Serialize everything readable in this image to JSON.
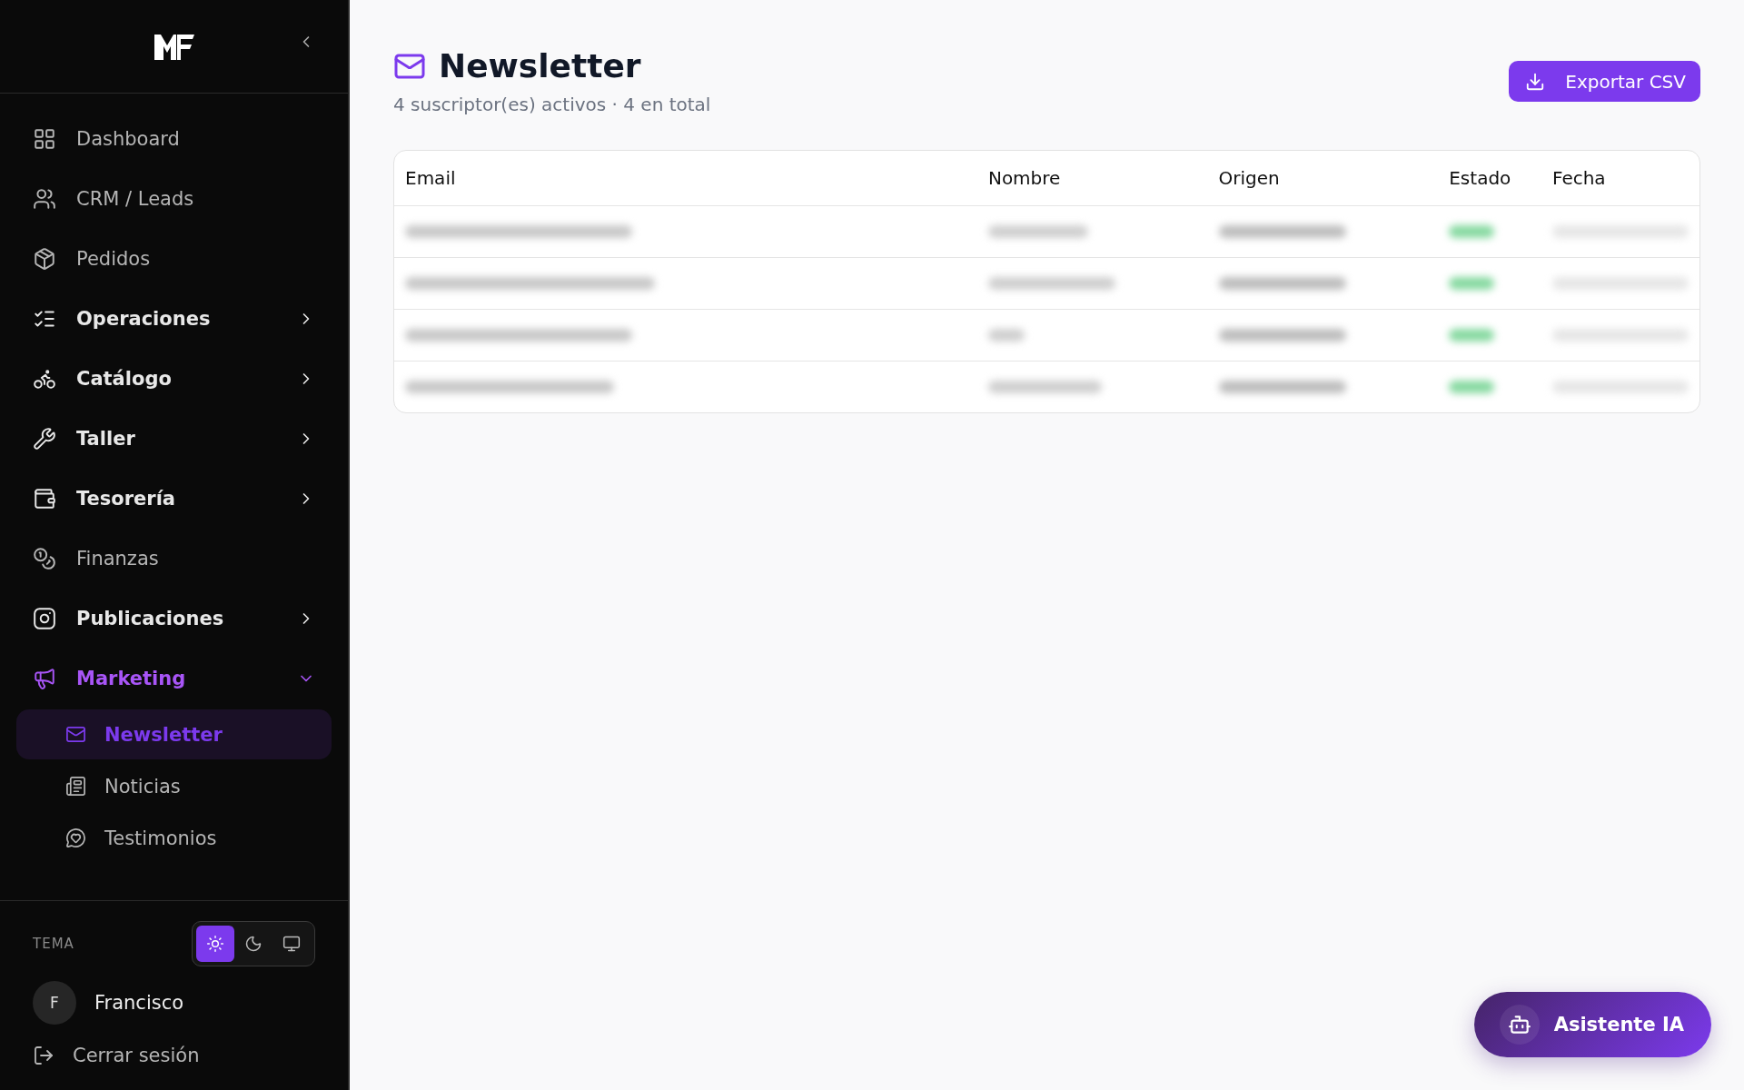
{
  "sidebar": {
    "items": [
      {
        "label": "Dashboard",
        "kind": "link",
        "selected": false
      },
      {
        "label": "CRM / Leads",
        "kind": "link",
        "selected": false
      },
      {
        "label": "Pedidos",
        "kind": "link",
        "selected": false
      },
      {
        "label": "Operaciones",
        "kind": "group",
        "expanded": false,
        "selected": false
      },
      {
        "label": "Catálogo",
        "kind": "group",
        "expanded": false,
        "selected": false
      },
      {
        "label": "Taller",
        "kind": "group",
        "expanded": false,
        "selected": false
      },
      {
        "label": "Tesorería",
        "kind": "group",
        "expanded": false,
        "selected": false
      },
      {
        "label": "Finanzas",
        "kind": "link",
        "selected": false
      },
      {
        "label": "Publicaciones",
        "kind": "group",
        "expanded": false,
        "selected": false
      },
      {
        "label": "Marketing",
        "kind": "group",
        "expanded": true,
        "selected": true,
        "children": [
          {
            "label": "Newsletter",
            "selected": true
          },
          {
            "label": "Noticias",
            "selected": false
          },
          {
            "label": "Testimonios",
            "selected": false
          }
        ]
      }
    ],
    "theme": {
      "label": "TEMA",
      "options": [
        {
          "selected": true
        },
        {
          "selected": false
        },
        {
          "selected": false
        }
      ]
    },
    "user": {
      "initial": "F",
      "name": "Francisco"
    },
    "logout": "Cerrar sesión"
  },
  "header": {
    "title": "Newsletter",
    "subtitle": "4 suscriptor(es) activos · 4 en total",
    "export_button": "Exportar CSV"
  },
  "table": {
    "columns": [
      "Email",
      "Nombre",
      "Origen",
      "Estado",
      "Fecha"
    ],
    "rows": [
      {
        "blurred": true
      },
      {
        "blurred": true
      },
      {
        "blurred": true
      },
      {
        "blurred": true
      }
    ]
  },
  "assistant_button": "Asistente IA"
}
